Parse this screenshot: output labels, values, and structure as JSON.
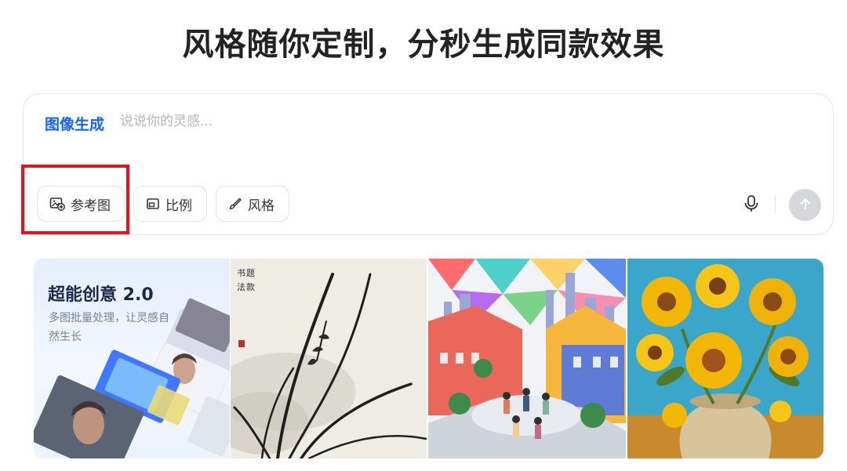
{
  "headline": "风格随你定制，分秒生成同款效果",
  "composer": {
    "mode_label": "图像生成",
    "prompt_placeholder": "说说你的灵感...",
    "prompt_value": "",
    "chips": {
      "reference_image": "参考图",
      "ratio": "比例",
      "style": "风格"
    },
    "mic_icon": "microphone-icon",
    "send_icon": "arrow-up-icon"
  },
  "gallery": {
    "promo": {
      "title": "超能创意 2.0",
      "subtitle": "多图批量处理，让灵感自然生长"
    },
    "items": [
      "promo-card",
      "ink-orchid-painting",
      "colorful-rooftop-party",
      "sunflowers-oil-painting"
    ]
  },
  "colors": {
    "accent": "#1664ff",
    "highlight": "#e8121b",
    "send_disabled": "#d6d7db"
  }
}
